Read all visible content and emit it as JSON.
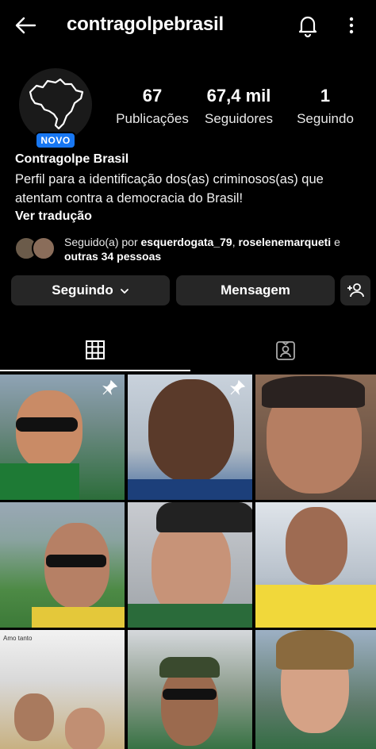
{
  "header": {
    "username": "contragolpebrasil"
  },
  "profile": {
    "badge": "NOVO",
    "stats": [
      {
        "value": "67",
        "label": "Publicações"
      },
      {
        "value": "67,4 mil",
        "label": "Seguidores"
      },
      {
        "value": "1",
        "label": "Seguindo"
      }
    ],
    "name": "Contragolpe Brasil",
    "bio": "Perfil para a identificação dos(as) criminosos(as) que atentam contra a democracia do Brasil!",
    "translate": "Ver tradução"
  },
  "followed_by": {
    "prefix": "Seguido(a) por",
    "user1": "esquerdogata_79",
    "sep": ",",
    "user2": "roselenemarqueti",
    "conj": "e",
    "others": "outras 34 pessoas"
  },
  "actions": {
    "following": "Seguindo",
    "message": "Mensagem"
  },
  "grid": {
    "tile_caption": "Amo tanto"
  },
  "colors": {
    "background": "#000000",
    "button": "#262626",
    "badge": "#1877f2"
  }
}
